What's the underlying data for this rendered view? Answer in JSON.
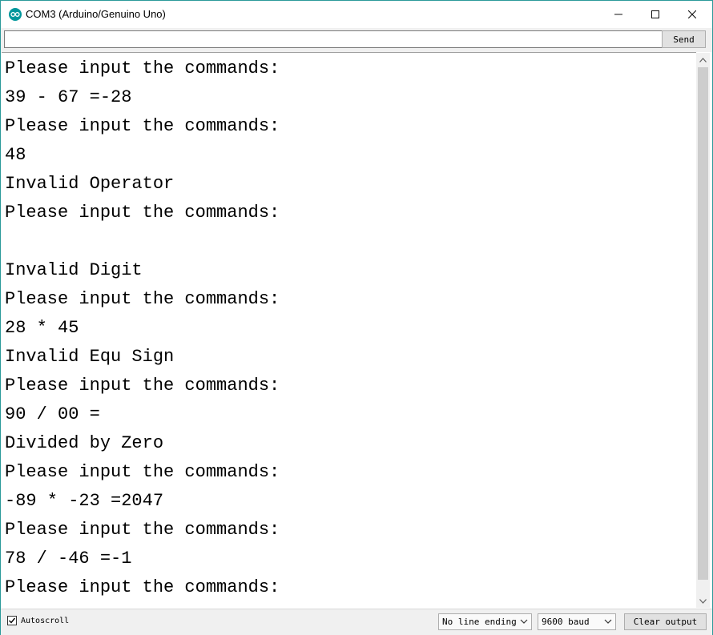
{
  "window": {
    "title": "COM3 (Arduino/Genuino Uno)",
    "icon": "arduino-logo-icon",
    "controls": [
      "minimize-icon",
      "maximize-icon",
      "close-icon"
    ]
  },
  "send_bar": {
    "input_value": "",
    "send_label": "Send"
  },
  "output": {
    "lines": [
      "Please input the commands:",
      "39 - 67 =-28",
      "Please input the commands:",
      "48",
      "Invalid Operator",
      "Please input the commands:",
      "",
      "Invalid Digit",
      "Please input the commands:",
      "28 * 45",
      "Invalid Equ Sign",
      "Please input the commands:",
      "90 / 00 =",
      "Divided by Zero",
      "Please input the commands:",
      "-89 * -23 =2047",
      "Please input the commands:",
      "78 / -46 =-1",
      "Please input the commands:"
    ]
  },
  "status_bar": {
    "autoscroll_label": "Autoscroll",
    "autoscroll_checked": true,
    "line_ending": "No line ending",
    "baud": "9600 baud",
    "clear_label": "Clear output"
  }
}
